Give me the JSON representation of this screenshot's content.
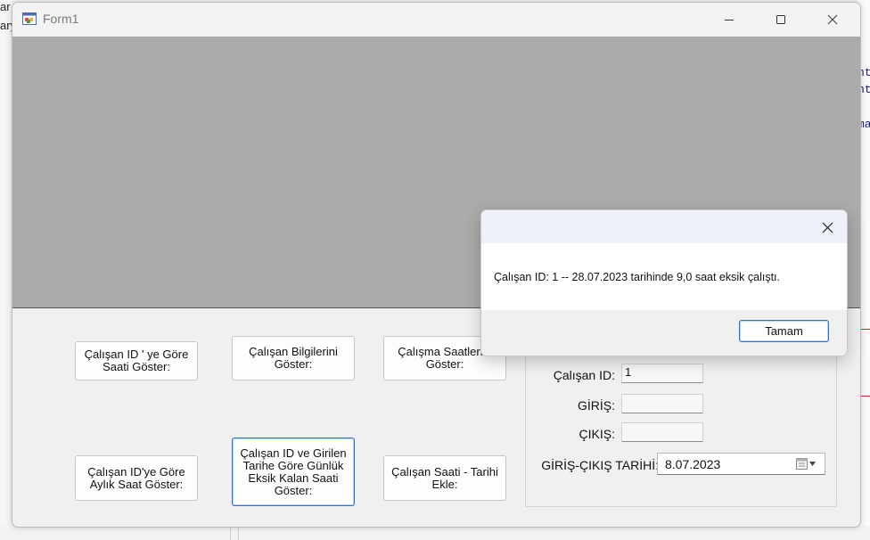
{
  "background": {
    "left_fragments": [
      "ar",
      "ary"
    ],
    "right_fragments": [
      "nt",
      "nt",
      "ma"
    ]
  },
  "window": {
    "title": "Form1",
    "icon": "winforms-app-icon",
    "controls": {
      "minimize": "minimize-icon",
      "maximize": "maximize-icon",
      "close": "close-icon"
    }
  },
  "buttons": {
    "show_hours_by_id": "Çalışan ID ' ye Göre Saati Göster:",
    "show_employee_info": "Çalışan Bilgilerini Göster:",
    "show_work_hours": "Çalışma Saatlerini Göster:",
    "show_monthly_hours": "Çalışan ID'ye Göre Aylık Saat Göster:",
    "show_daily_missing": "Çalışan ID ve Girilen Tarihe Göre Günlük Eksik Kalan Saati Göster:",
    "add_hours_date": "Çalışan Saati - Tarihi Ekle:"
  },
  "form": {
    "employee_id_label": "Çalışan ID:",
    "employee_id_value": "1",
    "entry_label": "GİRİŞ:",
    "entry_value": "",
    "exit_label": "ÇIKIŞ:",
    "exit_value": "",
    "date_label": "GİRİŞ-ÇIKIŞ TARİHİ:",
    "date_value": "8.07.2023"
  },
  "messagebox": {
    "text": "Çalışan ID: 1 -- 28.07.2023 tarihinde 9,0 saat eksik çalıştı.",
    "ok_label": "Tamam"
  },
  "colors": {
    "grid_background": "#ababab",
    "focus_accent": "#2a6fd6",
    "window_background": "#f0f0f0"
  }
}
